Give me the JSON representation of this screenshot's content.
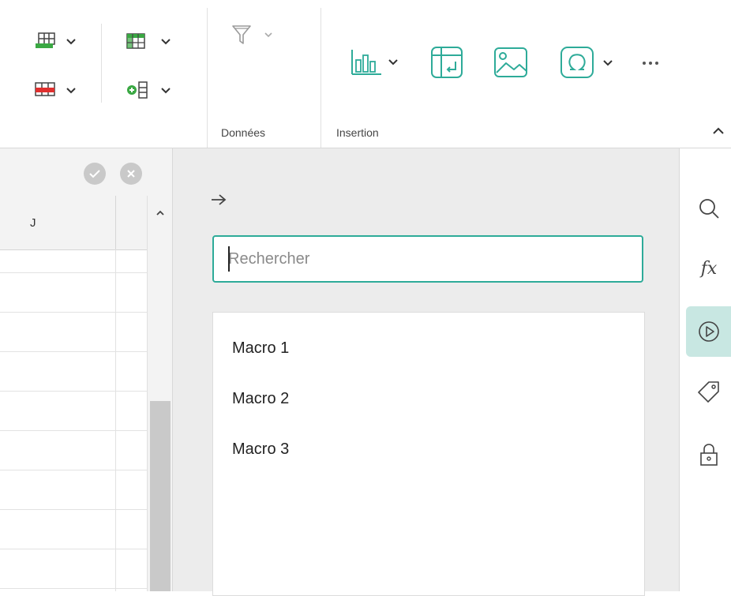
{
  "ribbon": {
    "groups": {
      "data_label": "Données",
      "insert_label": "Insertion"
    },
    "icons": {
      "insert_table_rows": "table-insert-icon",
      "delete_table_rows": "table-delete-icon",
      "table_style": "table-style-icon",
      "insert_cells": "insert-cells-icon",
      "filter": "filter-icon",
      "chart": "chart-icon",
      "pivot_table": "pivot-table-icon",
      "image": "image-icon",
      "symbol": "omega-icon",
      "more": "more-icon",
      "collapse": "chevron-up-icon"
    }
  },
  "sheet": {
    "column_header": "J",
    "accept_icon": "check-icon",
    "cancel_icon": "close-icon"
  },
  "panel": {
    "search_placeholder": "Rechercher",
    "macros": [
      "Macro 1",
      "Macro 2",
      "Macro 3"
    ]
  },
  "rail": {
    "items": [
      "search-icon",
      "function-icon",
      "macro-play-icon",
      "tag-icon",
      "lock-icon"
    ],
    "function_glyph": "fx"
  },
  "colors": {
    "accent": "#2eab99",
    "green": "#3aa843",
    "red": "#e0302f",
    "active_rail_bg": "#c8e7e2"
  }
}
